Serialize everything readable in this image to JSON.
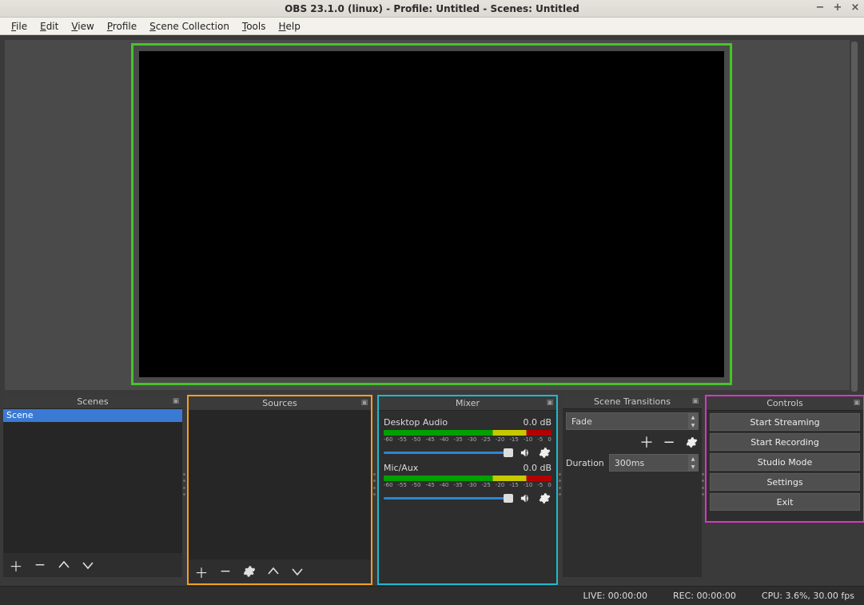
{
  "title": "OBS 23.1.0 (linux) - Profile: Untitled - Scenes: Untitled",
  "menu": {
    "file": "File",
    "edit": "Edit",
    "view": "View",
    "profile": "Profile",
    "scene_collection": "Scene Collection",
    "tools": "Tools",
    "help": "Help"
  },
  "panels": {
    "scenes_title": "Scenes",
    "sources_title": "Sources",
    "mixer_title": "Mixer",
    "transitions_title": "Scene Transitions",
    "controls_title": "Controls"
  },
  "scenes": {
    "items": [
      "Scene"
    ]
  },
  "mixer": {
    "channels": [
      {
        "name": "Desktop Audio",
        "level": "0.0 dB"
      },
      {
        "name": "Mic/Aux",
        "level": "0.0 dB"
      }
    ],
    "tick_labels": [
      "-60",
      "-55",
      "-50",
      "-45",
      "-40",
      "-35",
      "-30",
      "-25",
      "-20",
      "-15",
      "-10",
      "-5",
      "0"
    ]
  },
  "transitions": {
    "type": "Fade",
    "duration_label": "Duration",
    "duration_value": "300ms"
  },
  "controls": {
    "start_streaming": "Start Streaming",
    "start_recording": "Start Recording",
    "studio_mode": "Studio Mode",
    "settings": "Settings",
    "exit": "Exit"
  },
  "status": {
    "live": "LIVE: 00:00:00",
    "rec": "REC: 00:00:00",
    "cpu": "CPU: 3.6%, 30.00 fps"
  }
}
